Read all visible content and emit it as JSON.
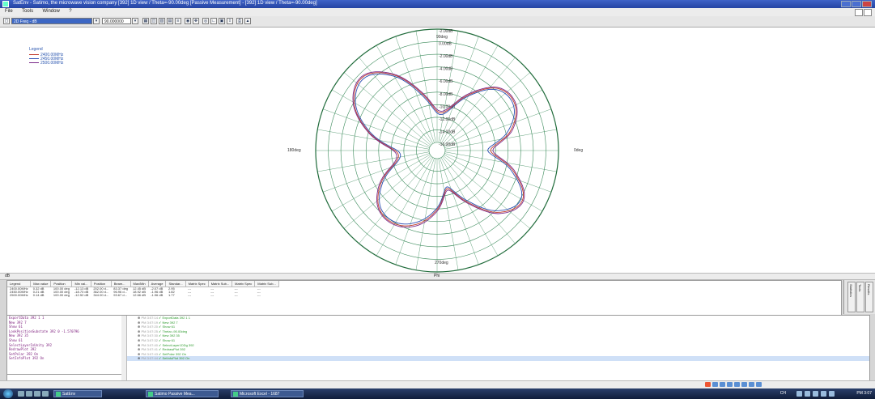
{
  "window": {
    "title": "SatEnv - Satimo, the microwave vision company [392] 1D view / Theta=-90.00deg [Passive Measurement] - [392] 1D view / Theta=-90.00deg]"
  },
  "menu": [
    "File",
    "Tools",
    "Window",
    "?"
  ],
  "toolbar": {
    "view_select": "2D Freq - dB",
    "value_select": "90.000000"
  },
  "polar": {
    "angle_labels": {
      "top": "90deg",
      "left": "180deg",
      "right": "0deg",
      "bottom": "270deg"
    },
    "ring_labels": [
      "-2.00dB",
      "0.00dB",
      "-2.00dB",
      "-4.00dB",
      "-6.00dB",
      "-8.00dB",
      "-10.00dB",
      "-12.00dB",
      "-14.00dB",
      "-16.00dB"
    ],
    "legend_title": "Legend",
    "legend_items": [
      {
        "label": "2400.00MHz",
        "color": "#c0392b"
      },
      {
        "label": "2450.00MHz",
        "color": "#2c4fb3"
      },
      {
        "label": "2500.00MHz",
        "color": "#7a2a8a"
      }
    ],
    "colors": {
      "grid": "#3a8a5a",
      "outer": "#1f6b3a"
    }
  },
  "chart_data": {
    "type": "polar-line",
    "rlim_db": [
      -18,
      2
    ],
    "series": [
      {
        "name": "2400.00MHz",
        "color": "#c0392b",
        "angles_deg": [
          0,
          15,
          30,
          45,
          60,
          75,
          90,
          105,
          120,
          135,
          150,
          165,
          180,
          195,
          210,
          225,
          240,
          255,
          270,
          285,
          300,
          315,
          330,
          345
        ],
        "gain_db": [
          -10,
          -6,
          -3.5,
          -4,
          -8,
          -12,
          -12.5,
          -9,
          -4,
          -1,
          -2.5,
          -7,
          -12,
          -12,
          -8,
          -5,
          -4.5,
          -6,
          -9,
          -12.5,
          -9,
          -4,
          -2,
          -5.5
        ]
      },
      {
        "name": "2450.00MHz",
        "color": "#2c4fb3",
        "angles_deg": [
          0,
          15,
          30,
          45,
          60,
          75,
          90,
          105,
          120,
          135,
          150,
          165,
          180,
          195,
          210,
          225,
          240,
          255,
          270,
          285,
          300,
          315,
          330,
          345
        ],
        "gain_db": [
          -10.5,
          -6.5,
          -3.8,
          -4.3,
          -8.3,
          -12.3,
          -12.8,
          -9.4,
          -4.3,
          -1.3,
          -2.8,
          -7.3,
          -12.4,
          -12.3,
          -8.4,
          -5.3,
          -4.8,
          -6.4,
          -9.3,
          -12.8,
          -9.4,
          -4.4,
          -2.3,
          -5.9
        ]
      },
      {
        "name": "2500.00MHz",
        "color": "#7a2a8a",
        "angles_deg": [
          0,
          15,
          30,
          45,
          60,
          75,
          90,
          105,
          120,
          135,
          150,
          165,
          180,
          195,
          210,
          225,
          240,
          255,
          270,
          285,
          300,
          315,
          330,
          345
        ],
        "gain_db": [
          -9.6,
          -5.7,
          -3.3,
          -3.8,
          -7.7,
          -11.7,
          -12.2,
          -8.7,
          -3.8,
          -0.8,
          -2.3,
          -6.8,
          -11.7,
          -11.7,
          -7.7,
          -4.8,
          -4.3,
          -5.7,
          -8.7,
          -12.2,
          -8.7,
          -3.7,
          -1.8,
          -5.2
        ]
      }
    ]
  },
  "separator": {
    "left": "dB",
    "center": "Phi"
  },
  "table": {
    "headers": [
      "Legend",
      "Max value",
      "Position",
      "Min val...",
      "Position",
      "Beam...",
      "Max/Min",
      "Average",
      "Standar...",
      "Matrix Spec",
      "Matrix Sub...",
      "Matrix Spec",
      "Matrix Sub..."
    ],
    "rows": [
      [
        "2400.00MHz",
        "0.32 dB",
        "100.00 deg",
        "-12.13 dB",
        "202.00 d...",
        "83.37 deg",
        "12.45 dB",
        "-2.07 dB",
        "2.95",
        "---",
        "---",
        "---",
        "---"
      ],
      [
        "2450.00MHz",
        "0.21 dB",
        "100.00 deg",
        "-18.70 dB",
        "362.00 d...",
        "96.96 d...",
        "18.92 dB",
        "-1.96 dB",
        "1.82",
        "---",
        "---",
        "---",
        "---"
      ],
      [
        "2500.00MHz",
        "0.14 dB",
        "100.00 deg",
        "-12.52 dB",
        "344.00 d...",
        "93.67 d...",
        "12.66 dB",
        "-1.96 dB",
        "1.77",
        "---",
        "---",
        "---",
        "---"
      ]
    ]
  },
  "side_tabs": [
    "Statistics",
    "Tools",
    "Results"
  ],
  "console_lines": [
    "ExportData 392 1 1",
    "New 392 7",
    "Show 61",
    "LookPositionSubstate 392 0 -1.570796",
    "New 392 35",
    "Show 61",
    "SelectLayerInUnity 392",
    "RedrawPlot 392",
    "SetPolar 392 On",
    "SetInfoPlot 392 On"
  ],
  "history": [
    {
      "time": "PM 3:07:14",
      "cmd": "ExportData 392 1 1"
    },
    {
      "time": "PM 3:07:19",
      "cmd": "New 392 7"
    },
    {
      "time": "PM 3:07:20",
      "cmd": "Show 61"
    },
    {
      "time": "PM 3:07:25",
      "cmd": "Theta=-90.00deg"
    },
    {
      "time": "PM 3:07:30",
      "cmd": "New 392 35"
    },
    {
      "time": "PM 3:07:32",
      "cmd": "Show 61"
    },
    {
      "time": "PM 3:07:40",
      "cmd": "SelectLayer1DDg 392"
    },
    {
      "time": "PM 3:07:41",
      "cmd": "RedrawPlot 392"
    },
    {
      "time": "PM 3:07:43",
      "cmd": "SetPolar 392 On"
    },
    {
      "time": "PM 3:07:44",
      "cmd": "SetInfoPlot 392 On"
    }
  ],
  "taskbar": {
    "tasks": [
      "SatEnv",
      "Satimo Passive Mea...",
      "Microsoft Excel - 1687"
    ],
    "lang": "CH",
    "clock": "PM 3:07"
  }
}
